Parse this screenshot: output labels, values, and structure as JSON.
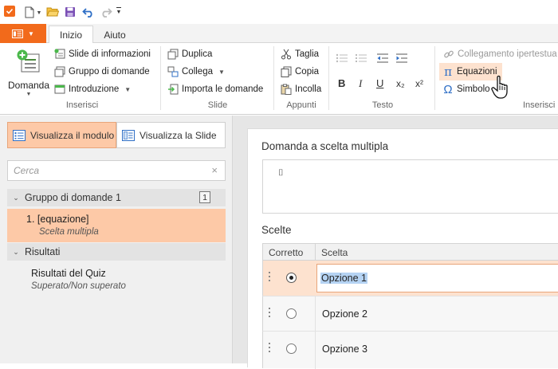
{
  "ribbon_tabs": {
    "inizio": "Inizio",
    "aiuto": "Aiuto"
  },
  "inserisci_group": {
    "domanda": "Domanda",
    "slide_info": "Slide di informazioni",
    "gruppo": "Gruppo di domande",
    "introduzione": "Introduzione",
    "label": "Inserisci"
  },
  "slide_group": {
    "duplica": "Duplica",
    "collega": "Collega",
    "importa": "Importa le domande",
    "label": "Slide"
  },
  "appunti_group": {
    "taglia": "Taglia",
    "copia": "Copia",
    "incolla": "Incolla",
    "label": "Appunti"
  },
  "testo_group": {
    "bold": "B",
    "italic": "I",
    "underline": "U",
    "subscript": "x₂",
    "superscript": "x²",
    "label": "Testo"
  },
  "inserisci_group2": {
    "collegamento": "Collegamento ipertestua",
    "equazioni": "Equazioni",
    "simbolo": "Simbolo",
    "label": "Inserisci"
  },
  "left_panel": {
    "view_module": "Visualizza il modulo",
    "view_slide": "Visualizza la Slide",
    "search_placeholder": "Cerca",
    "group_title": "Gruppo di domande 1",
    "group_count": "1",
    "item_title": "1.  [equazione]",
    "item_subtitle": "Scelta multipla",
    "results_title": "Risultati",
    "results_item_title": "Risultati del Quiz",
    "results_item_subtitle": "Superato/Non superato"
  },
  "editor": {
    "question_title": "Domanda a scelta multipla",
    "question_glyph": "⌷",
    "choices_title": "Scelte",
    "col_correct": "Corretto",
    "col_choice": "Scelta",
    "options": [
      "Opzione 1",
      "Opzione 2",
      "Opzione 3"
    ]
  },
  "colors": {
    "accent": "#f26a1b",
    "selection": "#fdc9a7",
    "hover": "#fde2cf"
  }
}
